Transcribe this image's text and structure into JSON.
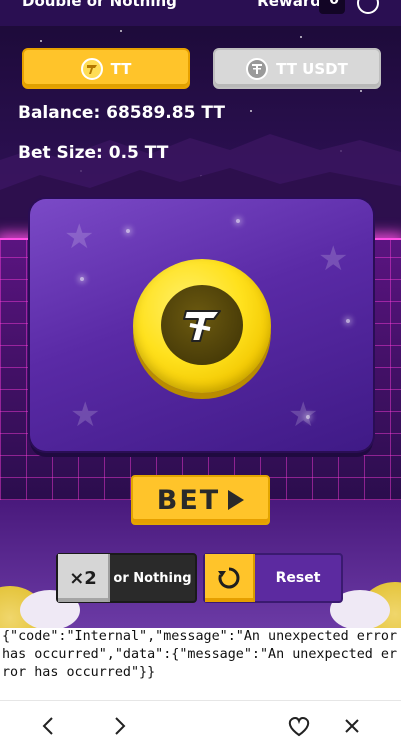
{
  "header": {
    "title": "Double or Nothing",
    "reward_label": "Reward",
    "reward_count": "0"
  },
  "tabs": [
    {
      "label": "TT",
      "icon": "tt-token-icon",
      "active": true,
      "color": "#ffc42a"
    },
    {
      "label": "TT USDT",
      "icon": "tether-icon",
      "active": false,
      "color": "#d8d8d8"
    }
  ],
  "balance": "Balance: 68589.85 TT",
  "bet_size": "Bet Size: 0.5 TT",
  "bet_button": {
    "label": "BET",
    "icon": "play-icon"
  },
  "double_button": {
    "multiplier": "×2",
    "label": "or Nothing"
  },
  "reset_button": {
    "label": "Reset",
    "icon": "reset-icon"
  },
  "error_text": "{\"code\":\"Internal\",\"message\":\"An unexpected error has occurred\",\"data\":{\"message\":\"An unexpected error has occurred\"}}",
  "nav": [
    "back-icon",
    "forward-icon",
    "heart-icon",
    "close-icon"
  ],
  "colors": {
    "accent": "#ffc42a",
    "purple": "#5c2aa0",
    "neon": "#ff4fe6"
  }
}
